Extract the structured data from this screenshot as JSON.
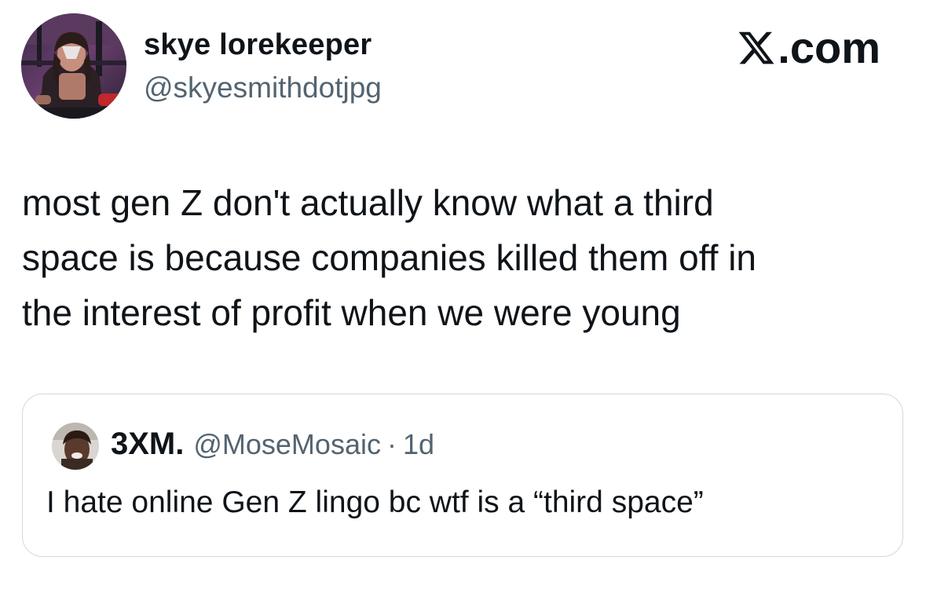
{
  "author": {
    "display_name": "skye lorekeeper",
    "handle": "@skyesmithdotjpg",
    "avatar_icon": "user-avatar-photo"
  },
  "brand": {
    "logo_icon": "x-logo-icon",
    "domain_suffix": ".com"
  },
  "tweet": {
    "text_lines": [
      "most gen Z don't actually know what a third",
      "space is because companies killed them off in",
      "the interest of profit when we were young"
    ]
  },
  "quoted_tweet": {
    "display_name": "3XM.",
    "handle": "@MoseMosaic",
    "separator": "·",
    "time": "1d",
    "text": "I hate online Gen Z lingo bc wtf is a “third space”",
    "avatar_icon": "user-avatar-photo"
  },
  "colors": {
    "text_primary": "#0f1419",
    "text_secondary": "#536471",
    "border": "#cfd9de",
    "background": "#ffffff"
  }
}
